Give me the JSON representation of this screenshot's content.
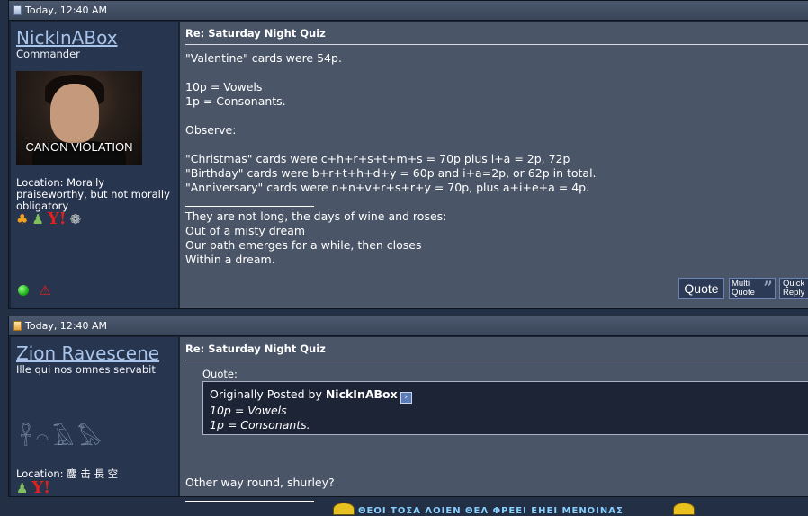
{
  "posts": [
    {
      "timestamp": "Today, 12:40 AM",
      "username": "NickInABox",
      "user_title": "Commander",
      "avatar_caption": "CANON VIOLATION",
      "location": "Location: Morally praiseworthy, but not morally obligatory",
      "im_icons": [
        "aim-icon",
        "msn-icon",
        "yahoo-icon",
        "skype-icon"
      ],
      "yahoo_glyph": "Y!",
      "title": "Re: Saturday Night Quiz",
      "body": "\"Valentine\" cards were 54p.\n\n10p = Vowels\n1p = Consonants.\n\nObserve:\n\n\"Christmas\" cards were c+h+r+s+t+m+s = 70p plus i+a = 2p, 72p\n\"Birthday\" cards were b+r+t+h+d+y = 60p and i+a=2p, or 62p in total.\n\"Anniversary\" cards were n+n+v+r+s+r+y = 70p, plus a+i+e+a = 4p.",
      "signature": "They are not long, the days of wine and roses:\nOut of a misty dream\nOur path emerges for a while, then closes\nWithin a dream.",
      "buttons": {
        "quote": "Quote",
        "multi_quote_1": "Multi",
        "multi_quote_2": "Quote",
        "quick_reply_1": "Quick",
        "quick_reply_2": "Reply"
      }
    },
    {
      "timestamp": "Today, 12:40 AM",
      "username": "Zion Ravescene",
      "user_title": "Ille qui nos omnes servabit",
      "location": "Location: 鏖 击 長 空",
      "im_icons": [
        "msn-icon",
        "yahoo-icon"
      ],
      "yahoo_glyph": "Y!",
      "title": "Re: Saturday Night Quiz",
      "quote_label": "Quote:",
      "quote_by_prefix": "Originally Posted by ",
      "quote_author": "NickInABox",
      "quote_lines": [
        "10p = Vowels",
        "1p = Consonants."
      ],
      "reply": "Other way round, shurley?",
      "signature": "ΘΕΟΙ ΤΟΣΑ ΛΟΙΕΝ ΘΕΛ ΦΡΕΕΙ ΕΗΕΙ ΜΕΝΟΙΝΑΣ"
    }
  ],
  "colors": {
    "page_bg": "#232f45",
    "header_bg": "#394559",
    "user_col_bg": "#28354f",
    "msg_col_bg": "#4b5568",
    "username_link": "#a8c4ea",
    "online": "#1fb51a"
  }
}
